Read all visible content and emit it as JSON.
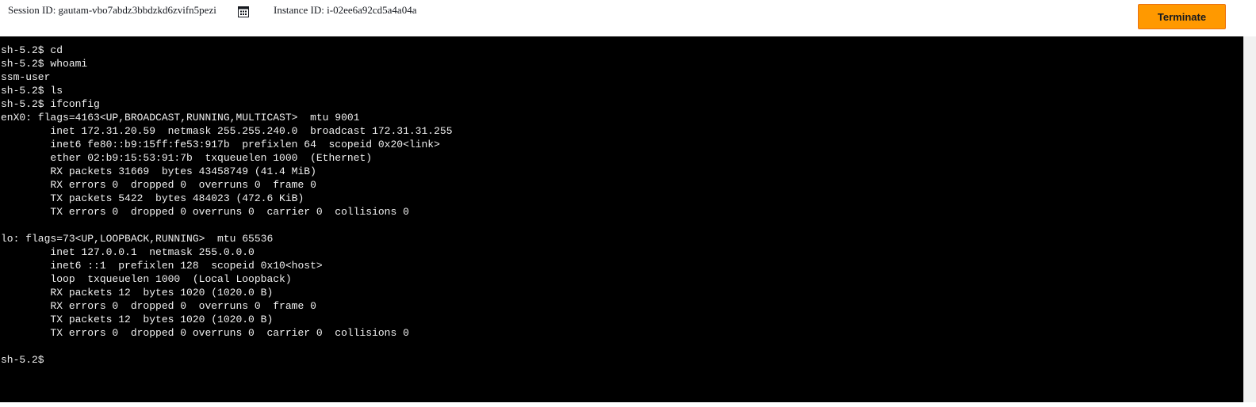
{
  "header": {
    "session_id_text": "Session ID: gautam-vbo7abdz3bbdzkd6zvifn5pezi",
    "instance_id_text": "Instance ID: i-02ee6a92cd5a4a04a",
    "copy_icon": "copy-icon",
    "terminate_label": "Terminate",
    "terminate_color": "#ff9900"
  },
  "terminal": {
    "background": "#000000",
    "text_color": "#f0f0f0",
    "lines": [
      "sh-5.2$ cd",
      "sh-5.2$ whoami",
      "ssm-user",
      "sh-5.2$ ls",
      "sh-5.2$ ifconfig",
      "enX0: flags=4163<UP,BROADCAST,RUNNING,MULTICAST>  mtu 9001",
      "        inet 172.31.20.59  netmask 255.255.240.0  broadcast 172.31.31.255",
      "        inet6 fe80::b9:15ff:fe53:917b  prefixlen 64  scopeid 0x20<link>",
      "        ether 02:b9:15:53:91:7b  txqueuelen 1000  (Ethernet)",
      "        RX packets 31669  bytes 43458749 (41.4 MiB)",
      "        RX errors 0  dropped 0  overruns 0  frame 0",
      "        TX packets 5422  bytes 484023 (472.6 KiB)",
      "        TX errors 0  dropped 0 overruns 0  carrier 0  collisions 0",
      "",
      "lo: flags=73<UP,LOOPBACK,RUNNING>  mtu 65536",
      "        inet 127.0.0.1  netmask 255.0.0.0",
      "        inet6 ::1  prefixlen 128  scopeid 0x10<host>",
      "        loop  txqueuelen 1000  (Local Loopback)",
      "        RX packets 12  bytes 1020 (1020.0 B)",
      "        RX errors 0  dropped 0  overruns 0  frame 0",
      "        TX packets 12  bytes 1020 (1020.0 B)",
      "        TX errors 0  dropped 0 overruns 0  carrier 0  collisions 0",
      "",
      "sh-5.2$ "
    ]
  }
}
